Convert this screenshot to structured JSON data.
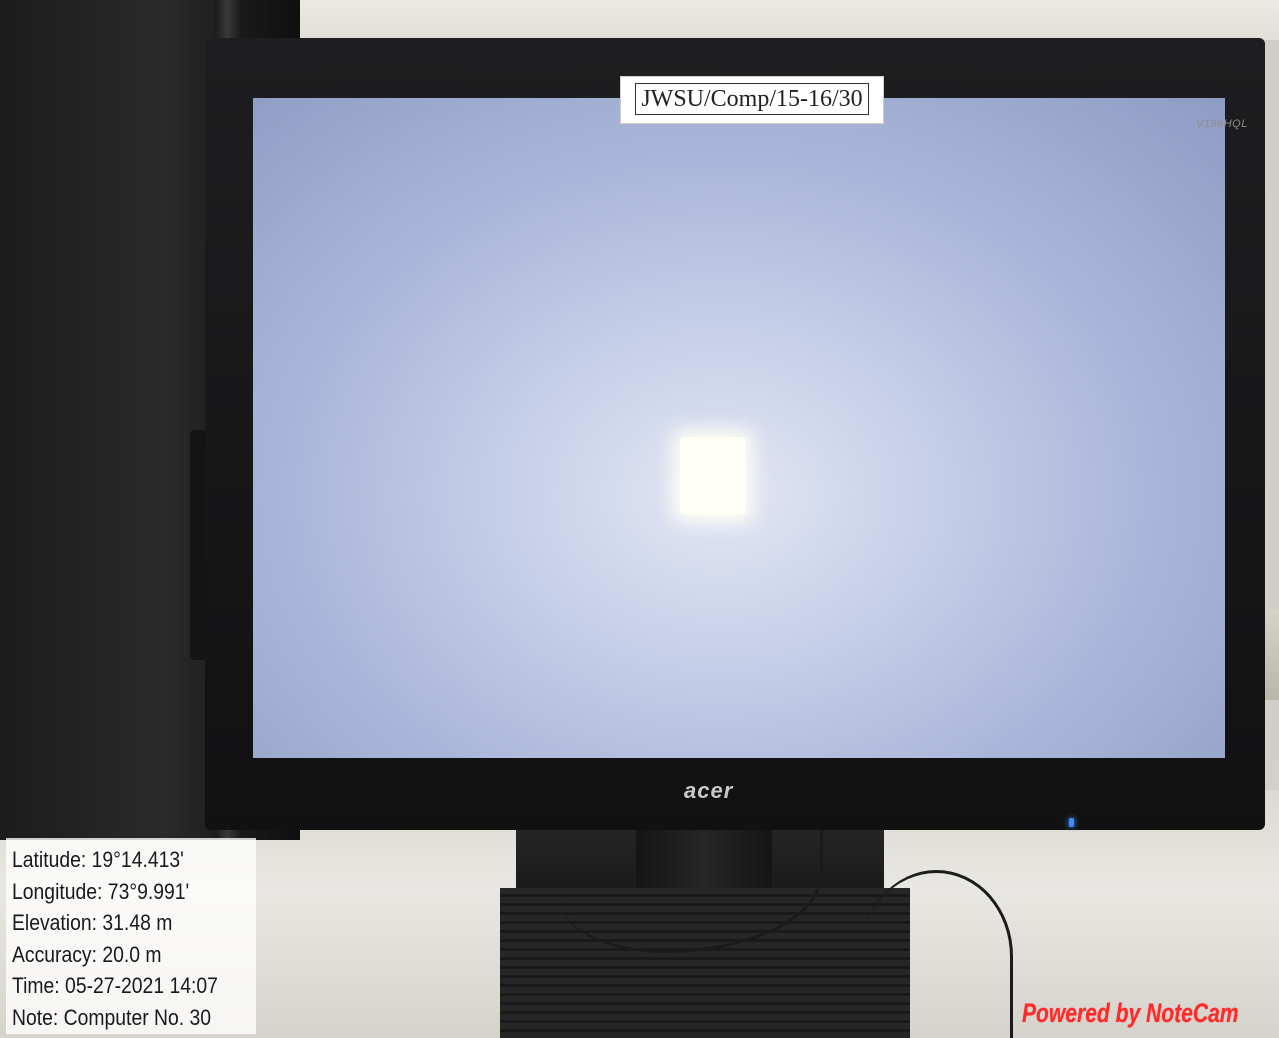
{
  "photo": {
    "description_subject": "monitor",
    "asset_label": "JWSU/Comp/15-16/30",
    "monitor_model": "V196HQL",
    "monitor_brand": "acer"
  },
  "overlay": {
    "latitude": "Latitude: 19°14.413'",
    "longitude": "Longitude: 73°9.991'",
    "elevation": "Elevation: 31.48 m",
    "accuracy": "Accuracy: 20.0 m",
    "time": "Time: 05-27-2021 14:07",
    "note": "Note: Computer No. 30"
  },
  "watermark": {
    "text": "Powered by NoteCam",
    "color": "#ff2a2a"
  }
}
